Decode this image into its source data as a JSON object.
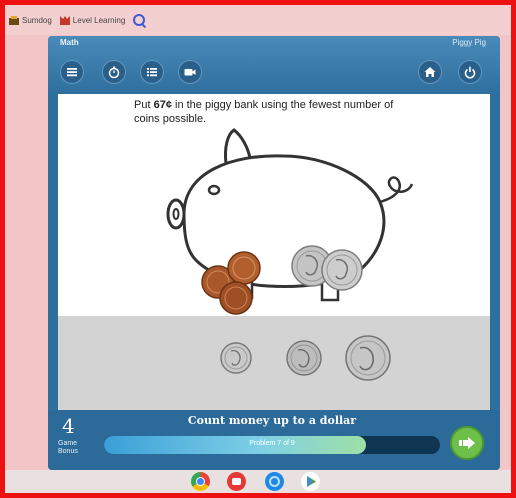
{
  "bookmarks": [
    {
      "label": "Sumdog",
      "icon": "sumdog-icon"
    },
    {
      "label": "Level Learning",
      "icon": "level-learning-icon"
    }
  ],
  "app": {
    "title": "Math",
    "user": "Piggy Pig",
    "question_prefix": "Put ",
    "question_amount": "67¢",
    "question_suffix": " in the piggy bank using the fewest number of coins possible.",
    "game_bonus_value": "4",
    "game_bonus_label": "Game Bonus",
    "topic": "Count money up to a dollar",
    "progress_text": "Problem 7 of 9",
    "progress_fraction": 0.78
  },
  "tray_coins": [
    {
      "name": "dime",
      "icon": "dime-coin-icon"
    },
    {
      "name": "nickel",
      "icon": "nickel-coin-icon"
    },
    {
      "name": "quarter",
      "icon": "quarter-coin-icon"
    }
  ],
  "piggy_coins": {
    "pennies": 3,
    "quarters": 2
  },
  "taskbar": [
    {
      "icon": "chrome-icon"
    },
    {
      "icon": "screencast-icon"
    },
    {
      "icon": "files-icon"
    },
    {
      "icon": "play-store-icon"
    }
  ],
  "colors": {
    "frame_border": "#ee1111",
    "app_blue": "#2f6f9e",
    "next_green": "#6cc04a"
  }
}
